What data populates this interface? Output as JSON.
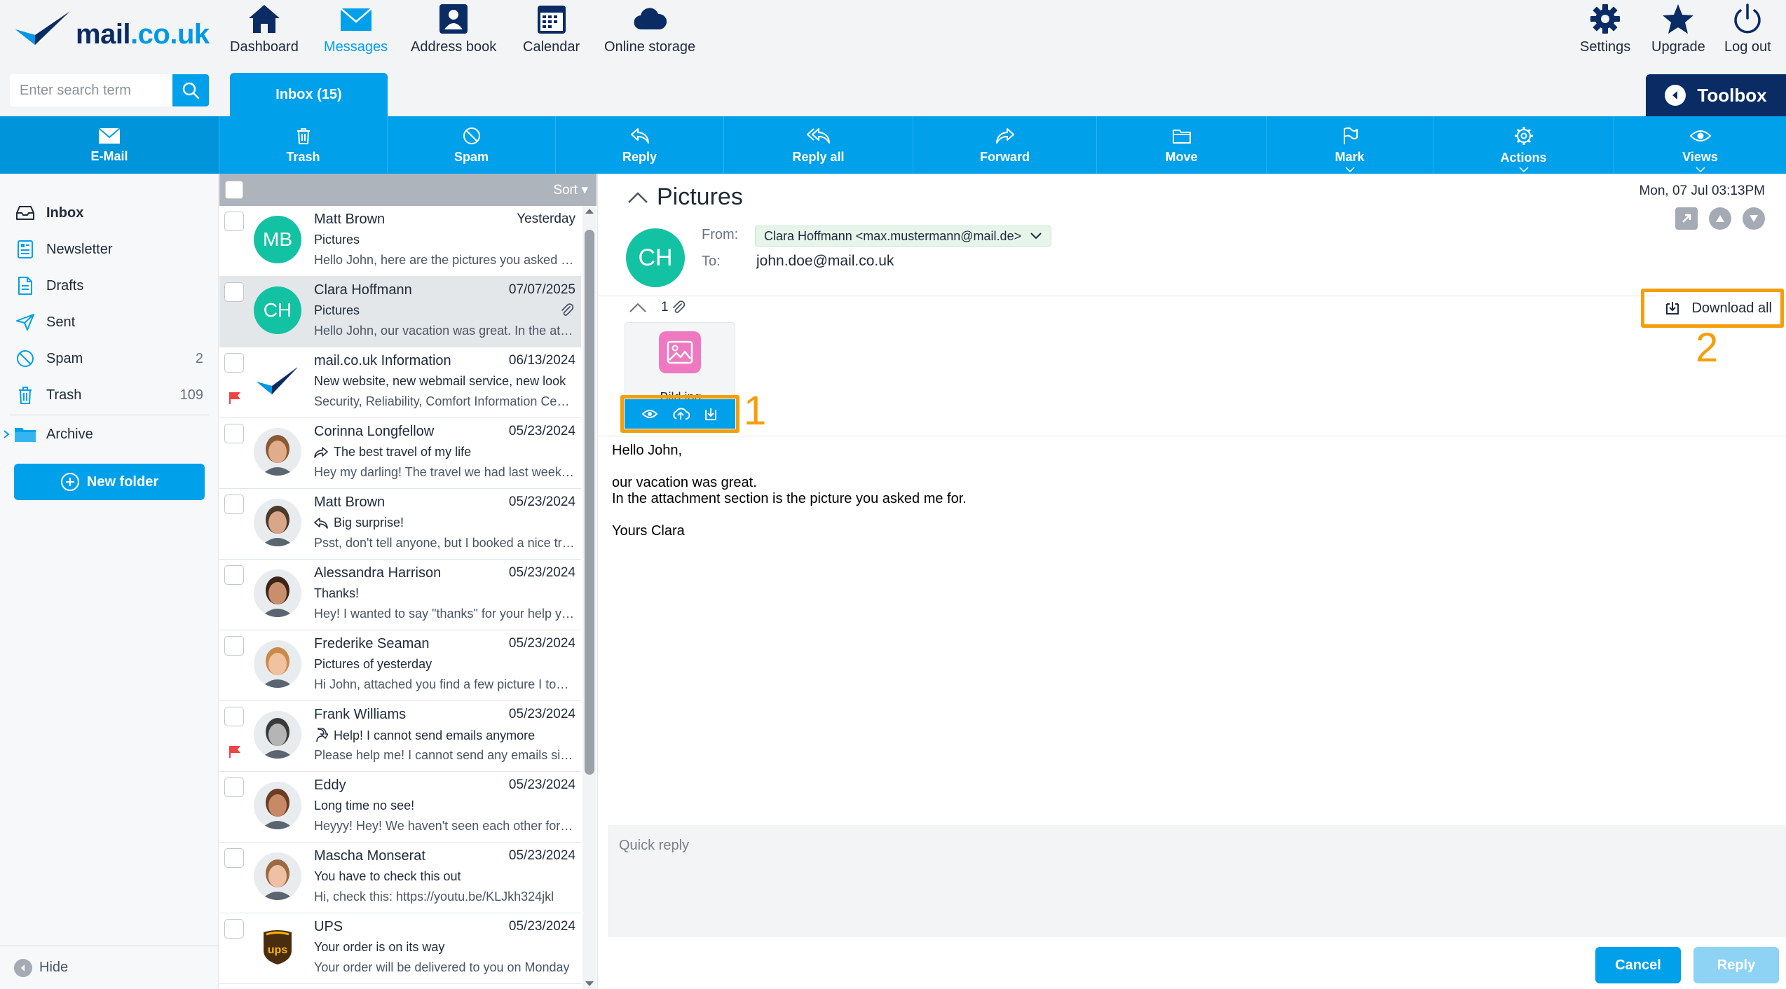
{
  "app": {
    "logo_text": "mail",
    "logo_tld": ".co.uk"
  },
  "search": {
    "placeholder": "Enter search term",
    "value": ""
  },
  "top_nav": [
    {
      "label": "Dashboard",
      "icon": "home-icon"
    },
    {
      "label": "Messages",
      "icon": "envelope-icon",
      "active": true
    },
    {
      "label": "Address book",
      "icon": "contact-card-icon"
    },
    {
      "label": "Calendar",
      "icon": "calendar-icon"
    },
    {
      "label": "Online storage",
      "icon": "cloud-icon"
    }
  ],
  "top_right": [
    {
      "label": "Settings",
      "icon": "gear-icon"
    },
    {
      "label": "Upgrade",
      "icon": "star-icon"
    },
    {
      "label": "Log out",
      "icon": "power-icon"
    }
  ],
  "inbox_tab": "Inbox (15)",
  "toolbox_label": "Toolbox",
  "toolbar": {
    "email": "E-Mail",
    "items": [
      {
        "label": "Trash",
        "icon": "trash-icon"
      },
      {
        "label": "Spam",
        "icon": "spam-icon"
      },
      {
        "label": "Reply",
        "icon": "reply-icon"
      },
      {
        "label": "Reply all",
        "icon": "reply-all-icon"
      },
      {
        "label": "Forward",
        "icon": "forward-icon"
      },
      {
        "label": "Move",
        "icon": "folder-icon"
      },
      {
        "label": "Mark",
        "icon": "flag-icon"
      },
      {
        "label": "Actions",
        "icon": "gear-icon"
      },
      {
        "label": "Views",
        "icon": "eye-icon"
      }
    ]
  },
  "folders": [
    {
      "name": "Inbox",
      "count": "",
      "icon": "inbox-icon"
    },
    {
      "name": "Newsletter",
      "count": "",
      "icon": "newsletter-icon"
    },
    {
      "name": "Drafts",
      "count": "",
      "icon": "draft-icon"
    },
    {
      "name": "Sent",
      "count": "",
      "icon": "paper-plane-icon"
    },
    {
      "name": "Spam",
      "count": "2",
      "icon": "spam-icon"
    },
    {
      "name": "Trash",
      "count": "109",
      "icon": "trash-icon"
    },
    {
      "name": "Archive",
      "count": "",
      "icon": "folder-icon"
    }
  ],
  "new_folder": "New folder",
  "hide_label": "Hide",
  "list": {
    "sort_label": "Sort",
    "messages": [
      {
        "sender": "Matt Brown",
        "date": "Yesterday",
        "subject": "Pictures",
        "preview": "Hello John, here are the pictures you asked for.",
        "initials": "MB",
        "avatar": "initials"
      },
      {
        "sender": "Clara Hoffmann",
        "date": "07/07/2025",
        "subject": "Pictures",
        "preview": "Hello John, our vacation was great. In the attachment section is the picture you asked me for.",
        "initials": "CH",
        "avatar": "initials",
        "attachment": true,
        "selected": true
      },
      {
        "sender": "mail.co.uk Information",
        "date": "06/13/2024",
        "subject": "New website, new webmail service, new look",
        "preview": "Security, Reliability, Comfort Information Center",
        "avatar": "logo",
        "flag": true
      },
      {
        "sender": "Corinna Longfellow",
        "date": "05/23/2024",
        "subject": "The best travel of my life",
        "preview": "Hey my darling! The travel we had last week was amazing",
        "avatar": "photo",
        "skin": "#e0ac8c",
        "hair": "#8a5a34",
        "status": "forwarded"
      },
      {
        "sender": "Matt Brown",
        "date": "05/23/2024",
        "subject": "Big surprise!",
        "preview": "Psst, don't tell anyone, but I booked a nice trip for us",
        "avatar": "photo",
        "skin": "#d9a68a",
        "hair": "#4a3a2c",
        "status": "replied"
      },
      {
        "sender": "Alessandra Harrison",
        "date": "05/23/2024",
        "subject": "Thanks!",
        "preview": "Hey! I wanted to say \"thanks\" for your help yesterday",
        "avatar": "photo",
        "skin": "#c98f6c",
        "hair": "#3b2418"
      },
      {
        "sender": "Frederike Seaman",
        "date": "05/23/2024",
        "subject": "Pictures of yesterday",
        "preview": "Hi John, attached you find a few picture I took yesterday",
        "avatar": "photo",
        "skin": "#f0c2a0",
        "hair": "#c98a4a"
      },
      {
        "sender": "Frank Williams",
        "date": "05/23/2024",
        "subject": "Help! I cannot send emails anymore",
        "preview": "Please help me! I cannot send any emails since yesterday",
        "avatar": "photo",
        "skin": "#b5b5b5",
        "hair": "#3a3a3a",
        "flag": true,
        "status": "redirected"
      },
      {
        "sender": "Eddy",
        "date": "05/23/2024",
        "subject": "Long time no see!",
        "preview": "Heyyy! Hey! We haven't seen each other for ages",
        "avatar": "photo",
        "skin": "#c88a66",
        "hair": "#6a3d24"
      },
      {
        "sender": "Mascha Monserat",
        "date": "05/23/2024",
        "subject": "You have to check this out",
        "preview": "Hi, check this: https://youtu.be/KLJkh324jkl",
        "avatar": "photo",
        "skin": "#efc0a4",
        "hair": "#9b6a40"
      },
      {
        "sender": "UPS",
        "date": "05/23/2024",
        "subject": "Your order is on its way",
        "preview": "Your order will be delivered to you on Monday",
        "avatar": "ups"
      }
    ]
  },
  "reader": {
    "subject": "Pictures",
    "date": "Mon, 07 Jul 03:13PM",
    "avatar_initials": "CH",
    "from_label": "From:",
    "from_value": "Clara Hoffmann <max.mustermann@mail.de>",
    "to_label": "To:",
    "to_value": "john.doe@mail.co.uk",
    "attachment_count": "1",
    "attachment_name": "Bild.jpg",
    "download_all": "Download all",
    "annotation_1": "1",
    "annotation_2": "2",
    "body": {
      "greeting": "Hello John,",
      "line1": "our vacation was great.",
      "line2": "In the attachment section is the picture you asked me for.",
      "closing": "Yours Clara"
    },
    "quick_reply_placeholder": "Quick reply",
    "cancel": "Cancel",
    "reply": "Reply"
  },
  "colors": {
    "brand_blue": "#00a0ea",
    "navy": "#0a2b63",
    "highlight": "#f59e0b",
    "avatar_teal": "#13c2a3"
  }
}
